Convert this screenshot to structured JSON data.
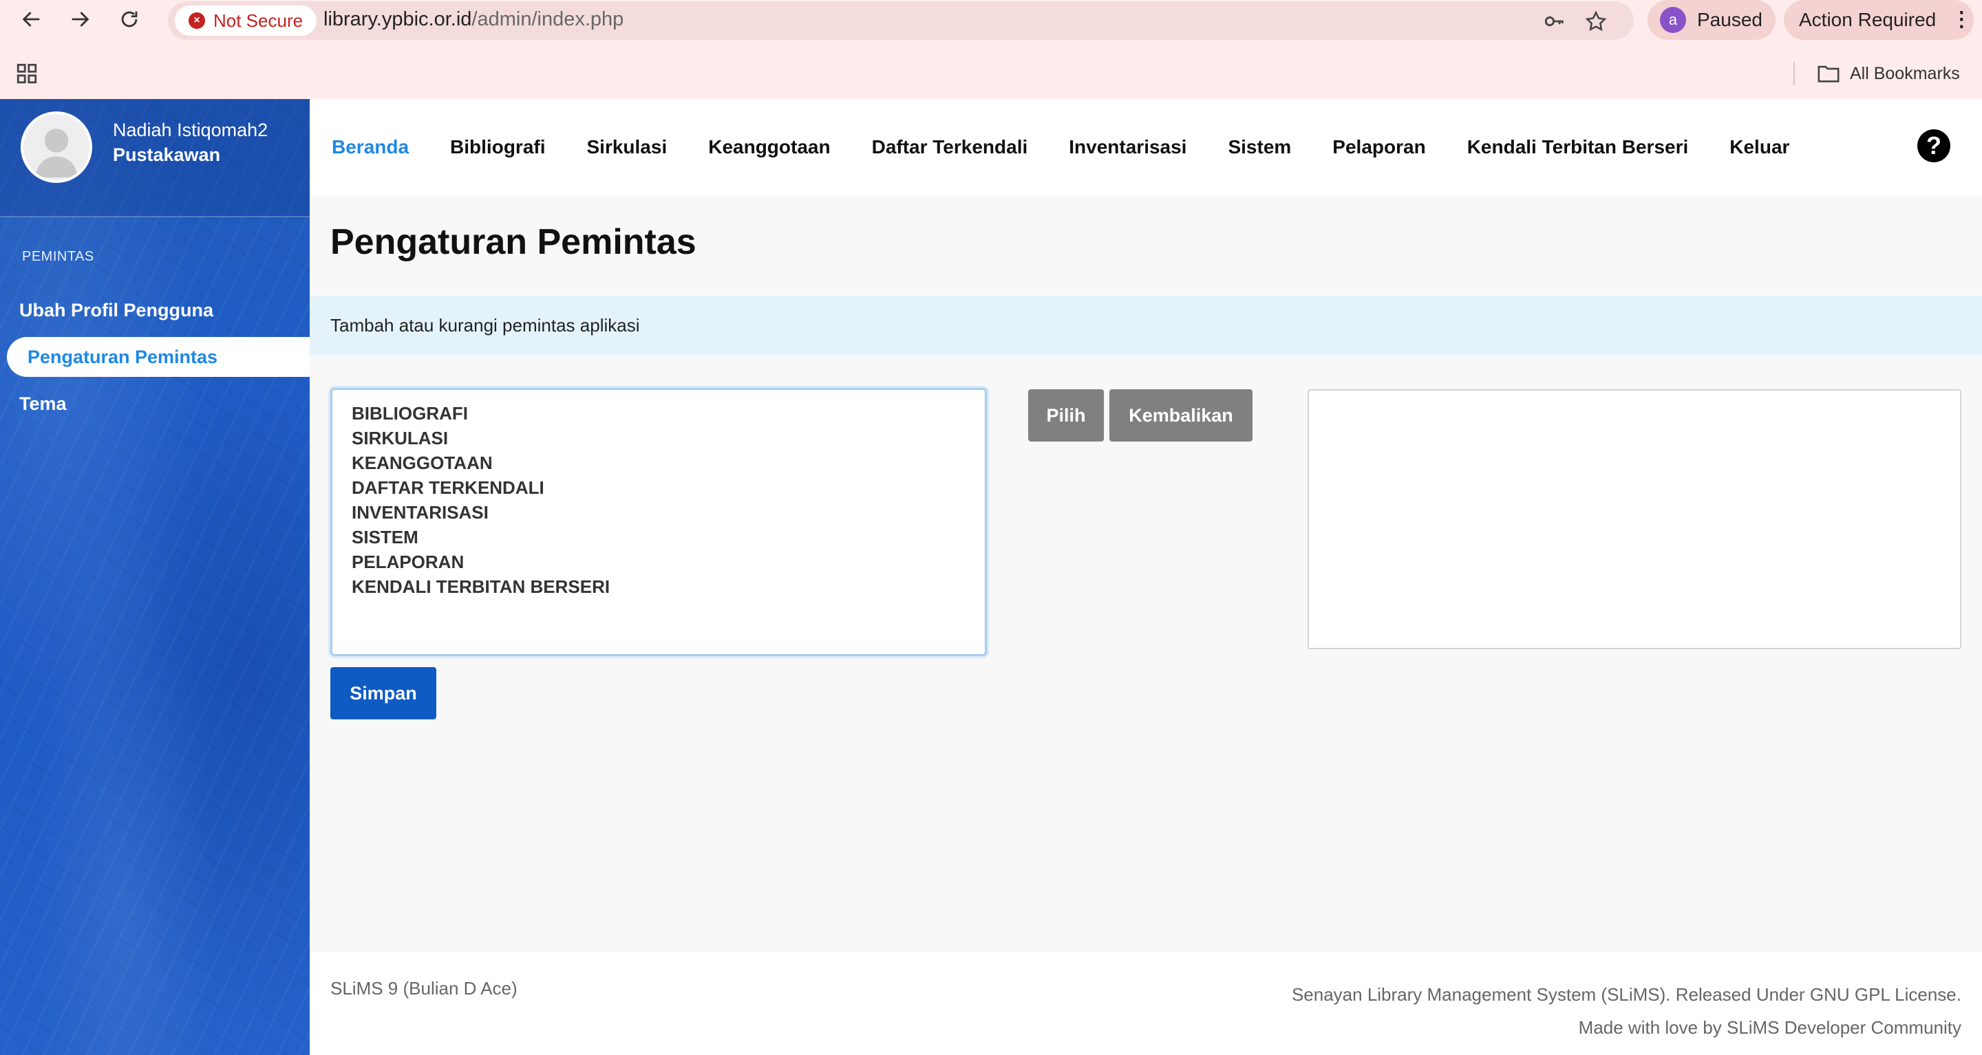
{
  "browser": {
    "security_label": "Not Secure",
    "url_host": "library.ypbic.or.id",
    "url_path": "/admin/index.php",
    "profile_initial": "a",
    "profile_status": "Paused",
    "action_label": "Action Required",
    "bookmarks_label": "All Bookmarks"
  },
  "sidebar": {
    "user_name": "Nadiah Istiqomah2",
    "user_role": "Pustakawan",
    "section_label": "PEMINTAS",
    "items": [
      {
        "label": "Ubah Profil Pengguna",
        "active": false
      },
      {
        "label": "Pengaturan Pemintas",
        "active": true
      },
      {
        "label": "Tema",
        "active": false
      }
    ]
  },
  "topnav": {
    "items": [
      "Beranda",
      "Bibliografi",
      "Sirkulasi",
      "Keanggotaan",
      "Daftar Terkendali",
      "Inventarisasi",
      "Sistem",
      "Pelaporan",
      "Kendali Terbitan Berseri",
      "Keluar"
    ],
    "active": "Beranda",
    "help_symbol": "?"
  },
  "main": {
    "title": "Pengaturan Pemintas",
    "info": "Tambah atau kurangi pemintas aplikasi",
    "modules": [
      "BIBLIOGRAFI",
      "SIRKULASI",
      "KEANGGOTAAN",
      "DAFTAR TERKENDALI",
      "INVENTARISASI",
      "SISTEM",
      "PELAPORAN",
      "KENDALI TERBITAN BERSERI"
    ],
    "select_button": "Pilih",
    "remove_button": "Kembalikan",
    "save_button": "Simpan"
  },
  "footer": {
    "version": "SLiMS 9 (Bulian D Ace)",
    "license": "Senayan Library Management System (SLiMS). Released Under GNU GPL License.",
    "credit": "Made with love by SLiMS Developer Community"
  },
  "colors": {
    "accent": "#1e88e5",
    "sidebar": "#1f5ec7",
    "save_button": "#0e5bc4",
    "gray_button": "#808080",
    "info_bar": "#e4f3fb",
    "warning": "#c5221f"
  }
}
